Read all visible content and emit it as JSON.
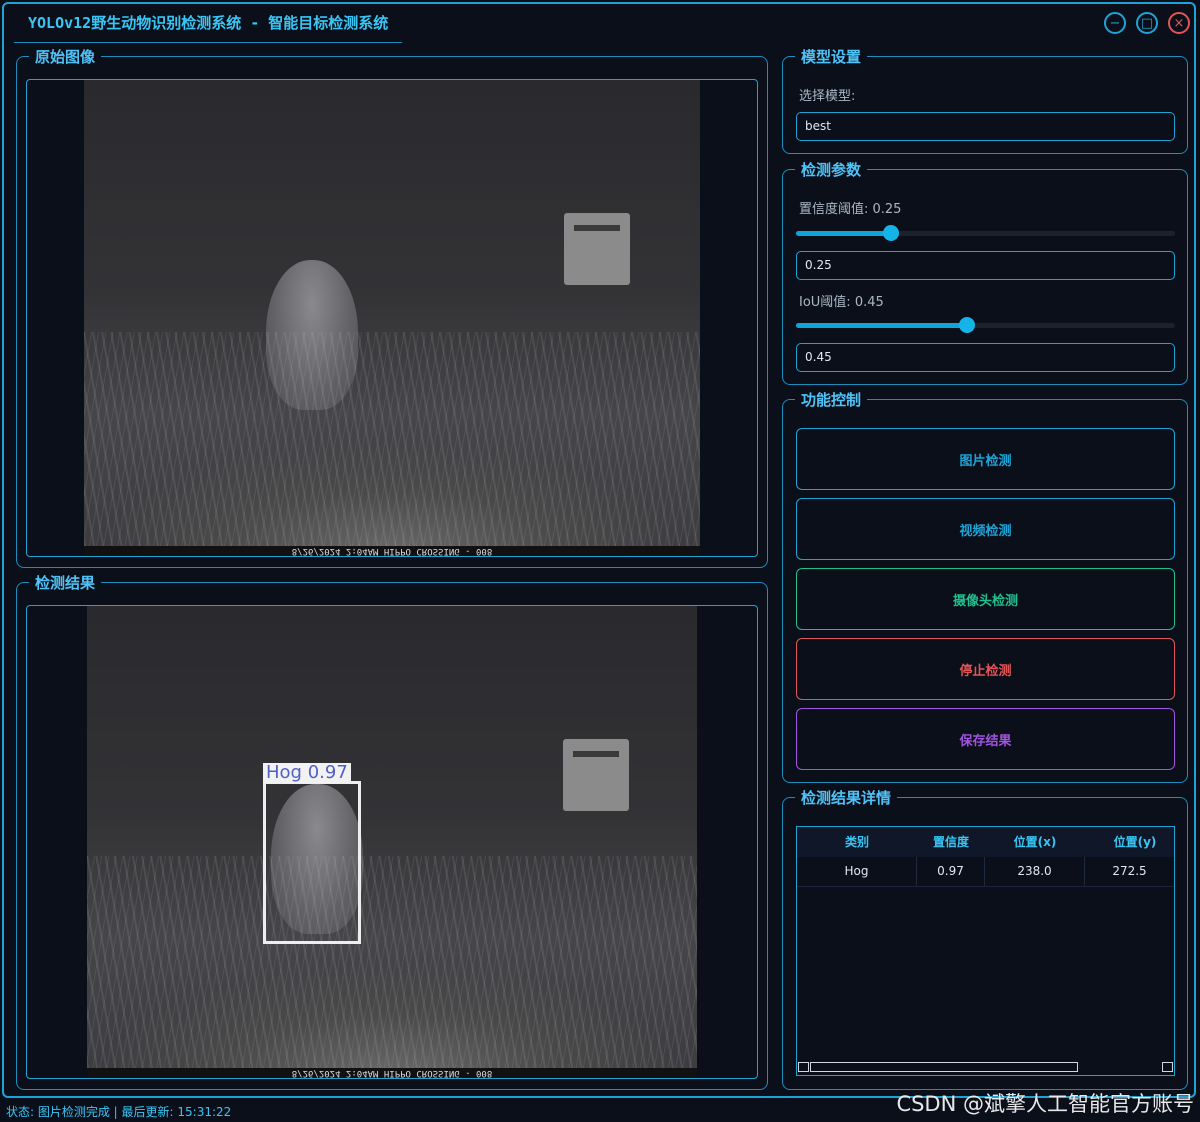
{
  "app": {
    "title": "YOLOv12野生动物识别检测系统 - 智能目标检测系统",
    "minimize_icon": "−",
    "maximize_icon": "□",
    "close_icon": "×"
  },
  "original_panel": {
    "title": "原始图像",
    "image_footer": "8/26/2024 2:04AM HIPPO CROSSING - 008"
  },
  "result_panel": {
    "title": "检测结果",
    "image_footer": "8/26/2024 2:04AM HIPPO CROSSING - 008",
    "detection_label": "Hog 0.97"
  },
  "model_settings": {
    "title": "模型设置",
    "select_label": "选择模型:",
    "model_value": "best"
  },
  "params": {
    "title": "检测参数",
    "conf_label": "置信度阈值: 0.25",
    "conf_slider_fraction": 0.25,
    "conf_value": "0.25",
    "iou_label": "IoU阈值: 0.45",
    "iou_slider_fraction": 0.45,
    "iou_value": "0.45"
  },
  "controls": {
    "title": "功能控制",
    "image_detect": "图片检测",
    "video_detect": "视频检测",
    "camera_detect": "摄像头检测",
    "stop_detect": "停止检测",
    "save_result": "保存结果",
    "colors": {
      "image": "#1fa3d6",
      "video": "#1fa3d6",
      "camera": "#1fbf8f",
      "stop": "#e05656",
      "save": "#a054e0"
    }
  },
  "details": {
    "title": "检测结果详情",
    "columns": [
      "类别",
      "置信度",
      "位置(x)",
      "位置(y)"
    ],
    "rows": [
      [
        "Hog",
        "0.97",
        "238.0",
        "272.5"
      ]
    ]
  },
  "status": {
    "text": "状态: 图片检测完成 | 最后更新: 15:31:22"
  },
  "watermark": "CSDN @斌擎人工智能官方账号"
}
